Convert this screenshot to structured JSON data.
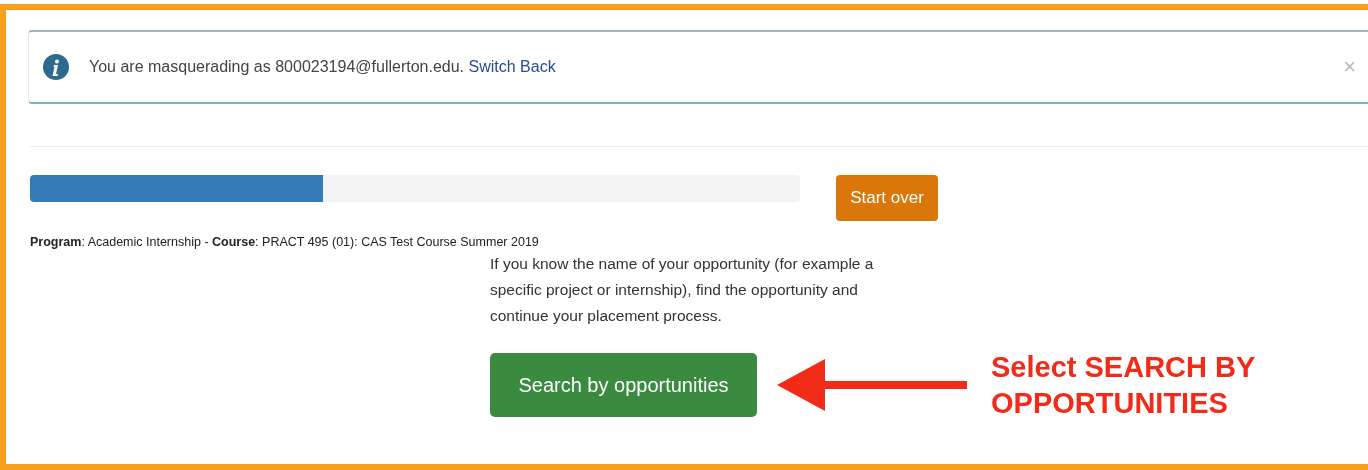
{
  "alert": {
    "message": "You are masquerading as 800023194@fullerton.edu.",
    "link": "Switch Back",
    "close": "×"
  },
  "progress": {
    "level": 0.38
  },
  "start_over": "Start over",
  "program_line": "**Program**: Academic Internship - **Course**: PRACT 495 (01): CAS Test Course Summer 2019",
  "intro": "If you know the name of your opportunity (for example a specific project or internship), find the opportunity and continue your placement process.",
  "search_button": "Search by opportunities",
  "annotation": "Select SEARCH BY OPPORTUNITIES"
}
